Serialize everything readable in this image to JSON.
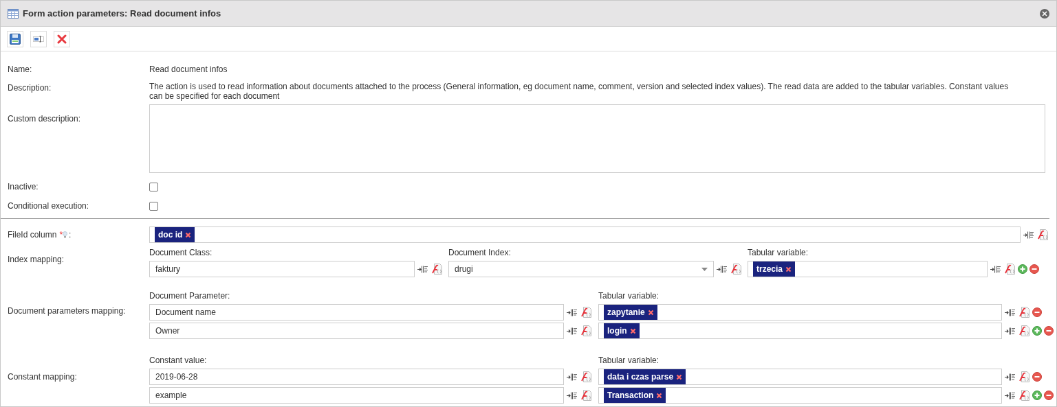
{
  "window": {
    "title": "Form action parameters: Read document infos"
  },
  "name": {
    "label": "Name:",
    "value": "Read document infos"
  },
  "description": {
    "label": "Description:",
    "value": "The action is used to read information about documents attached to the process (General information, eg document name, comment, version and selected index values). The read data are added to the tabular variables. Constant values can be specified for each document"
  },
  "custom_description": {
    "label": "Custom description:"
  },
  "inactive": {
    "label": "Inactive:",
    "checked": false
  },
  "conditional_execution": {
    "label": "Conditional execution:",
    "checked": false
  },
  "fileid_column": {
    "label": "FileId column",
    "required": "*",
    "suffix": ":",
    "tags": [
      "doc id"
    ]
  },
  "index_mapping": {
    "label": "Index mapping:",
    "headers": [
      "Document Class:",
      "Document Index:",
      "Tabular variable:"
    ],
    "rows": [
      {
        "document_class": "faktury",
        "document_index": "drugi",
        "tags": [
          "trzecia"
        ],
        "add_button": true
      }
    ]
  },
  "document_parameters_mapping": {
    "label": "Document parameters mapping:",
    "headers": [
      "Document Parameter:",
      "Tabular variable:"
    ],
    "rows": [
      {
        "value": "Document name",
        "tags": [
          "zapytanie"
        ],
        "add_button": false
      },
      {
        "value": "Owner",
        "tags": [
          "login"
        ],
        "add_button": true
      }
    ]
  },
  "constant_mapping": {
    "label": "Constant mapping:",
    "headers": [
      "Constant value:",
      "Tabular variable:"
    ],
    "rows": [
      {
        "value": "2019-06-28",
        "tags": [
          "data i czas parse"
        ],
        "add_button": false
      },
      {
        "value": "example",
        "tags": [
          "Transaction"
        ],
        "add_button": true
      }
    ]
  }
}
